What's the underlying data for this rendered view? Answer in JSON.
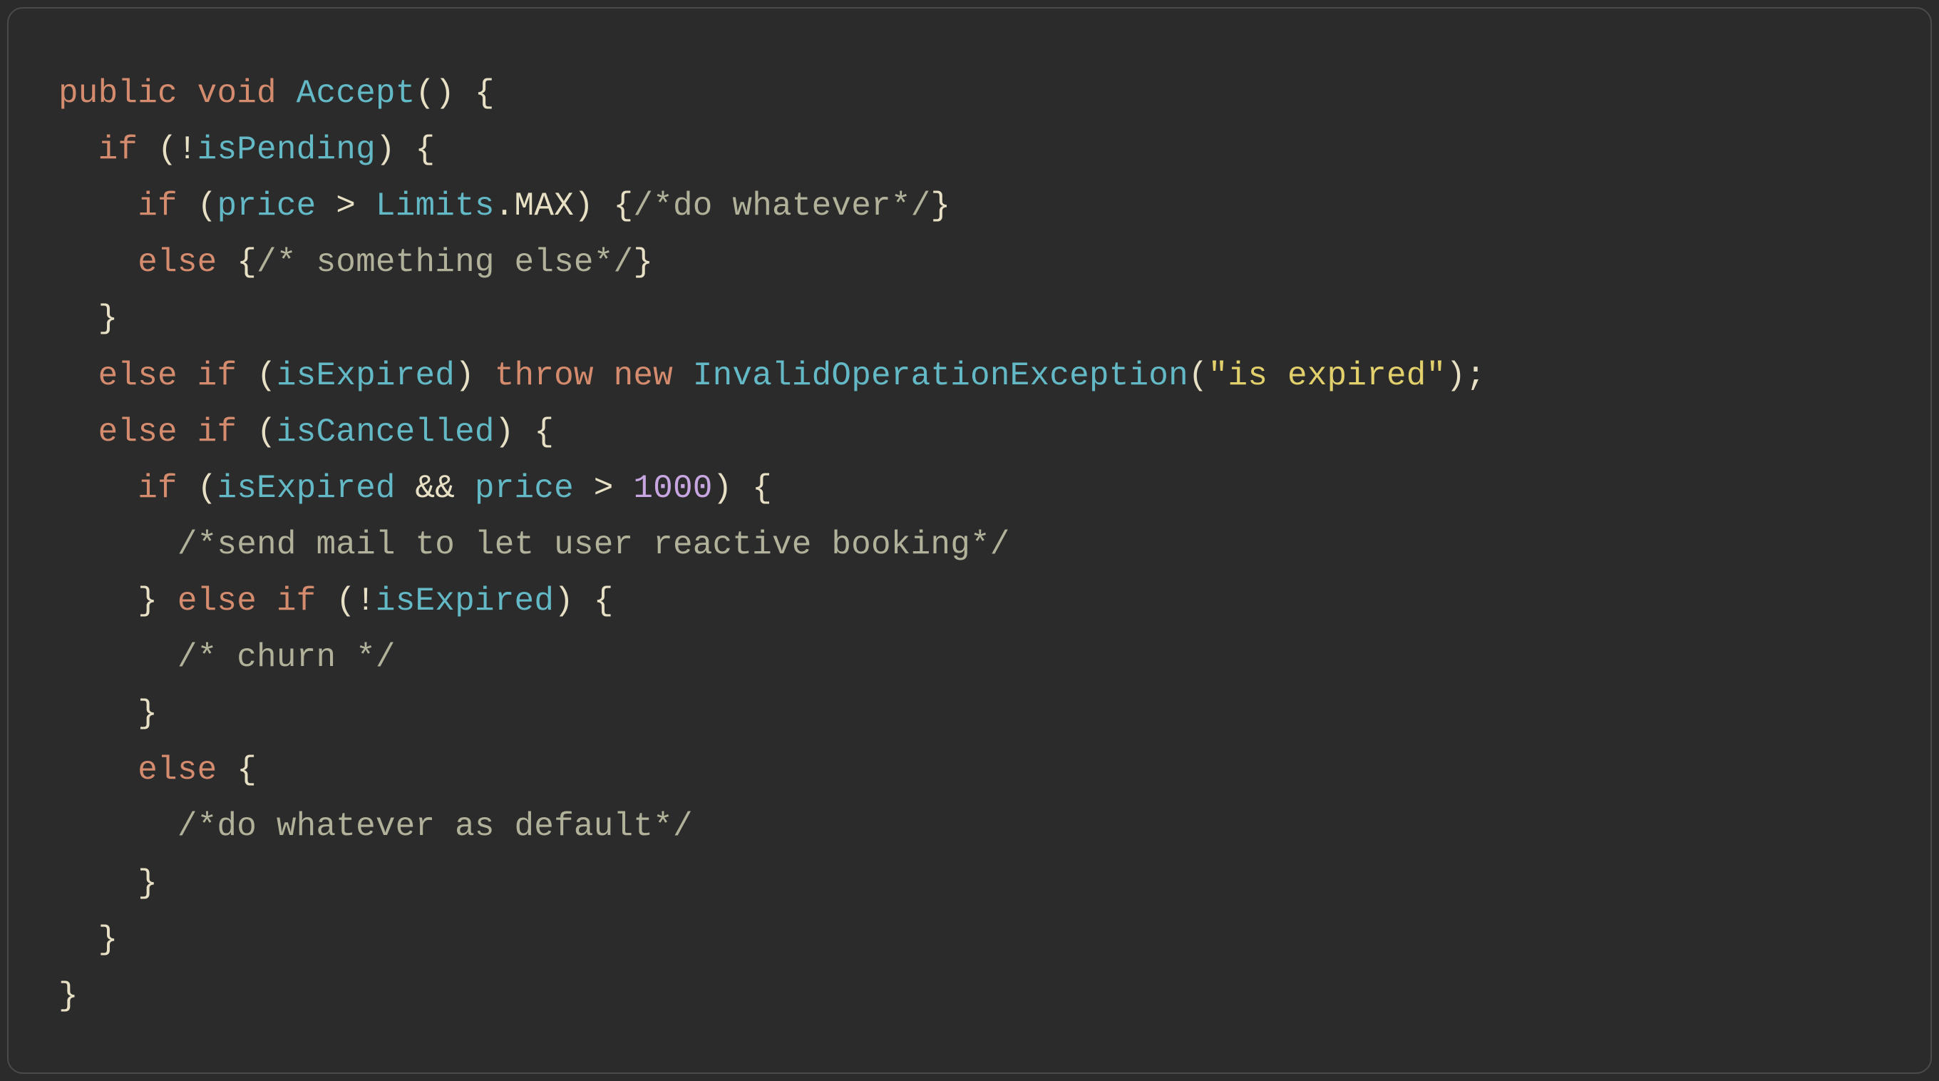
{
  "colors": {
    "background": "#2b2b2b",
    "border": "#4a4a4a",
    "default": "#e8e0c5",
    "keyword": "#d58b6d",
    "identifier": "#63b9c6",
    "number": "#c7a6e2",
    "string": "#e2d06c",
    "comment": "#b2b19a"
  },
  "lines": [
    {
      "indent": 0,
      "tokens": [
        {
          "t": "keyword",
          "s": "public"
        },
        {
          "t": "punc",
          "s": " "
        },
        {
          "t": "keyword",
          "s": "void"
        },
        {
          "t": "punc",
          "s": " "
        },
        {
          "t": "func",
          "s": "Accept"
        },
        {
          "t": "punc",
          "s": "() {"
        }
      ]
    },
    {
      "indent": 1,
      "tokens": [
        {
          "t": "keyword",
          "s": "if"
        },
        {
          "t": "punc",
          "s": " (!"
        },
        {
          "t": "ident",
          "s": "isPending"
        },
        {
          "t": "punc",
          "s": ") {"
        }
      ]
    },
    {
      "indent": 2,
      "tokens": [
        {
          "t": "keyword",
          "s": "if"
        },
        {
          "t": "punc",
          "s": " ("
        },
        {
          "t": "ident",
          "s": "price"
        },
        {
          "t": "punc",
          "s": " > "
        },
        {
          "t": "ident",
          "s": "Limits"
        },
        {
          "t": "punc",
          "s": "."
        },
        {
          "t": "prop",
          "s": "MAX"
        },
        {
          "t": "punc",
          "s": ") {"
        },
        {
          "t": "comment",
          "s": "/*do whatever*/"
        },
        {
          "t": "punc",
          "s": "}"
        }
      ]
    },
    {
      "indent": 2,
      "tokens": [
        {
          "t": "keyword",
          "s": "else"
        },
        {
          "t": "punc",
          "s": " {"
        },
        {
          "t": "comment",
          "s": "/* something else*/"
        },
        {
          "t": "punc",
          "s": "}"
        }
      ]
    },
    {
      "indent": 1,
      "tokens": [
        {
          "t": "punc",
          "s": "}"
        }
      ]
    },
    {
      "indent": 1,
      "tokens": [
        {
          "t": "keyword",
          "s": "else"
        },
        {
          "t": "punc",
          "s": " "
        },
        {
          "t": "keyword",
          "s": "if"
        },
        {
          "t": "punc",
          "s": " ("
        },
        {
          "t": "ident",
          "s": "isExpired"
        },
        {
          "t": "punc",
          "s": ") "
        },
        {
          "t": "keyword",
          "s": "throw"
        },
        {
          "t": "punc",
          "s": " "
        },
        {
          "t": "keyword",
          "s": "new"
        },
        {
          "t": "punc",
          "s": " "
        },
        {
          "t": "class",
          "s": "InvalidOperationException"
        },
        {
          "t": "punc",
          "s": "("
        },
        {
          "t": "str",
          "s": "\"is expired\""
        },
        {
          "t": "punc",
          "s": ");"
        }
      ]
    },
    {
      "indent": 1,
      "tokens": [
        {
          "t": "keyword",
          "s": "else"
        },
        {
          "t": "punc",
          "s": " "
        },
        {
          "t": "keyword",
          "s": "if"
        },
        {
          "t": "punc",
          "s": " ("
        },
        {
          "t": "ident",
          "s": "isCancelled"
        },
        {
          "t": "punc",
          "s": ") {"
        }
      ]
    },
    {
      "indent": 2,
      "tokens": [
        {
          "t": "keyword",
          "s": "if"
        },
        {
          "t": "punc",
          "s": " ("
        },
        {
          "t": "ident",
          "s": "isExpired"
        },
        {
          "t": "punc",
          "s": " && "
        },
        {
          "t": "ident",
          "s": "price"
        },
        {
          "t": "punc",
          "s": " > "
        },
        {
          "t": "num",
          "s": "1000"
        },
        {
          "t": "punc",
          "s": ") {"
        }
      ]
    },
    {
      "indent": 3,
      "tokens": [
        {
          "t": "comment",
          "s": "/*send mail to let user reactive booking*/"
        }
      ]
    },
    {
      "indent": 2,
      "tokens": [
        {
          "t": "punc",
          "s": "} "
        },
        {
          "t": "keyword",
          "s": "else"
        },
        {
          "t": "punc",
          "s": " "
        },
        {
          "t": "keyword",
          "s": "if"
        },
        {
          "t": "punc",
          "s": " (!"
        },
        {
          "t": "ident",
          "s": "isExpired"
        },
        {
          "t": "punc",
          "s": ") {"
        }
      ]
    },
    {
      "indent": 3,
      "tokens": [
        {
          "t": "comment",
          "s": "/* churn */"
        }
      ]
    },
    {
      "indent": 2,
      "tokens": [
        {
          "t": "punc",
          "s": "}"
        }
      ]
    },
    {
      "indent": 2,
      "tokens": [
        {
          "t": "keyword",
          "s": "else"
        },
        {
          "t": "punc",
          "s": " {"
        }
      ]
    },
    {
      "indent": 3,
      "tokens": [
        {
          "t": "comment",
          "s": "/*do whatever as default*/"
        }
      ]
    },
    {
      "indent": 2,
      "tokens": [
        {
          "t": "punc",
          "s": "}"
        }
      ]
    },
    {
      "indent": 1,
      "tokens": [
        {
          "t": "punc",
          "s": "}"
        }
      ]
    },
    {
      "indent": 0,
      "tokens": [
        {
          "t": "punc",
          "s": "}"
        }
      ]
    }
  ]
}
